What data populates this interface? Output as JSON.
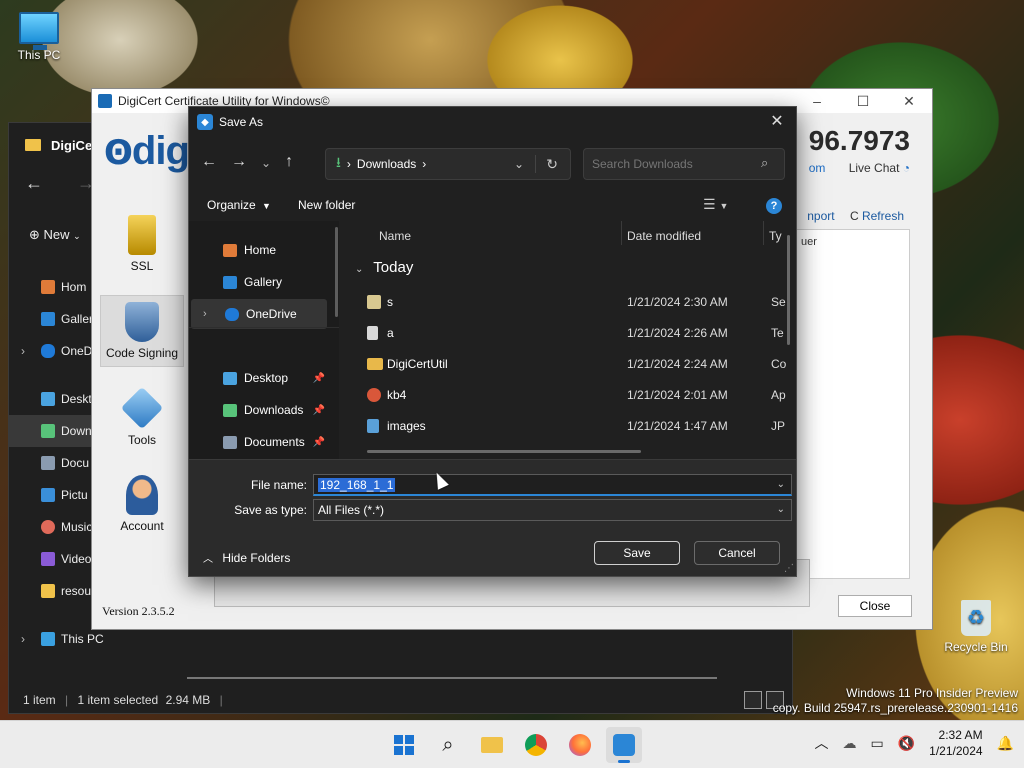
{
  "desktop": {
    "icons": [
      {
        "label": "This PC"
      },
      {
        "label": "Recycle Bin"
      }
    ],
    "watermark": {
      "line1": "Windows 11 Pro Insider Preview",
      "line2": "copy. Build 25947.rs_prerelease.230901-1416"
    }
  },
  "explorer": {
    "title": "DigiCer",
    "new_label": "New",
    "sidebar": [
      {
        "label": "Hom",
        "color": "#e07b39"
      },
      {
        "label": "Galler",
        "color": "#2b86d6"
      },
      {
        "label": "OneD",
        "color": "#1f7ad8",
        "expandable": true
      },
      {
        "label": "Deskt",
        "color": "#4aa3e0"
      },
      {
        "label": "Down",
        "color": "#58c37a",
        "active": true
      },
      {
        "label": "Docu",
        "color": "#8a9bb0"
      },
      {
        "label": "Pictu",
        "color": "#3a8fd9"
      },
      {
        "label": "Music",
        "color": "#e06a5a"
      },
      {
        "label": "Video",
        "color": "#8a5bd6"
      },
      {
        "label": "resou",
        "color": "#f0c24a"
      },
      {
        "label": "This PC",
        "color": "#3aa0e0",
        "expandable": true
      }
    ],
    "status": {
      "items": "1 item",
      "selected": "1 item selected",
      "size": "2.94 MB"
    }
  },
  "digicert": {
    "title": "DigiCert Certificate Utility for Windows©",
    "logo_text": "digi",
    "phone": "96.7973",
    "sub_link": "om",
    "live_chat": "Live Chat",
    "toolbar_right": {
      "import": "nport",
      "refresh": "Refresh"
    },
    "panel_text": "uer",
    "tools": [
      {
        "label": "SSL",
        "color": "#d9a300"
      },
      {
        "label": "Code Signing",
        "color": "#3f6fa8",
        "selected": true
      },
      {
        "label": "Tools",
        "color": "#3a8fd9"
      },
      {
        "label": "Account",
        "color": "#c97a4a"
      }
    ],
    "version": "Version 2.3.5.2",
    "close_label": "Close"
  },
  "save_as": {
    "title": "Save As",
    "address": {
      "location": "Downloads"
    },
    "search_placeholder": "Search Downloads",
    "toolbar": {
      "organize": "Organize",
      "new_folder": "New folder"
    },
    "nav_pane": [
      {
        "label": "Home",
        "color": "#e07b39"
      },
      {
        "label": "Gallery",
        "color": "#2b86d6"
      },
      {
        "label": "OneDrive",
        "color": "#1f7ad8",
        "active": true,
        "expandable": true
      },
      {
        "label": "Desktop",
        "color": "#4aa3e0",
        "pinned": true
      },
      {
        "label": "Downloads",
        "color": "#58c37a",
        "pinned": true
      },
      {
        "label": "Documents",
        "color": "#8a9bb0",
        "pinned": true
      }
    ],
    "columns": {
      "name": "Name",
      "date": "Date modified",
      "type": "Ty"
    },
    "group": "Today",
    "files": [
      {
        "name": "s",
        "date": "1/21/2024 2:30 AM",
        "type": "Se",
        "color": "#d8c890"
      },
      {
        "name": "a",
        "date": "1/21/2024 2:26 AM",
        "type": "Te",
        "color": "#d8d8d8"
      },
      {
        "name": "DigiCertUtil",
        "date": "1/21/2024 2:24 AM",
        "type": "Co",
        "color": "#e8b84a"
      },
      {
        "name": "kb4",
        "date": "1/21/2024 2:01 AM",
        "type": "Ap",
        "color": "#d9573a"
      },
      {
        "name": "images",
        "date": "1/21/2024 1:47 AM",
        "type": "JP",
        "color": "#5aa0d8"
      }
    ],
    "file_name_label": "File name:",
    "file_name_value": "192_168_1_1",
    "save_type_label": "Save as type:",
    "save_type_value": "All Files (*.*)",
    "hide_folders": "Hide Folders",
    "save_label": "Save",
    "cancel_label": "Cancel"
  },
  "taskbar": {
    "apps": [
      "start",
      "search",
      "file-explorer",
      "chrome",
      "firefox",
      "digicert"
    ],
    "time": "2:32 AM",
    "date": "1/21/2024"
  }
}
